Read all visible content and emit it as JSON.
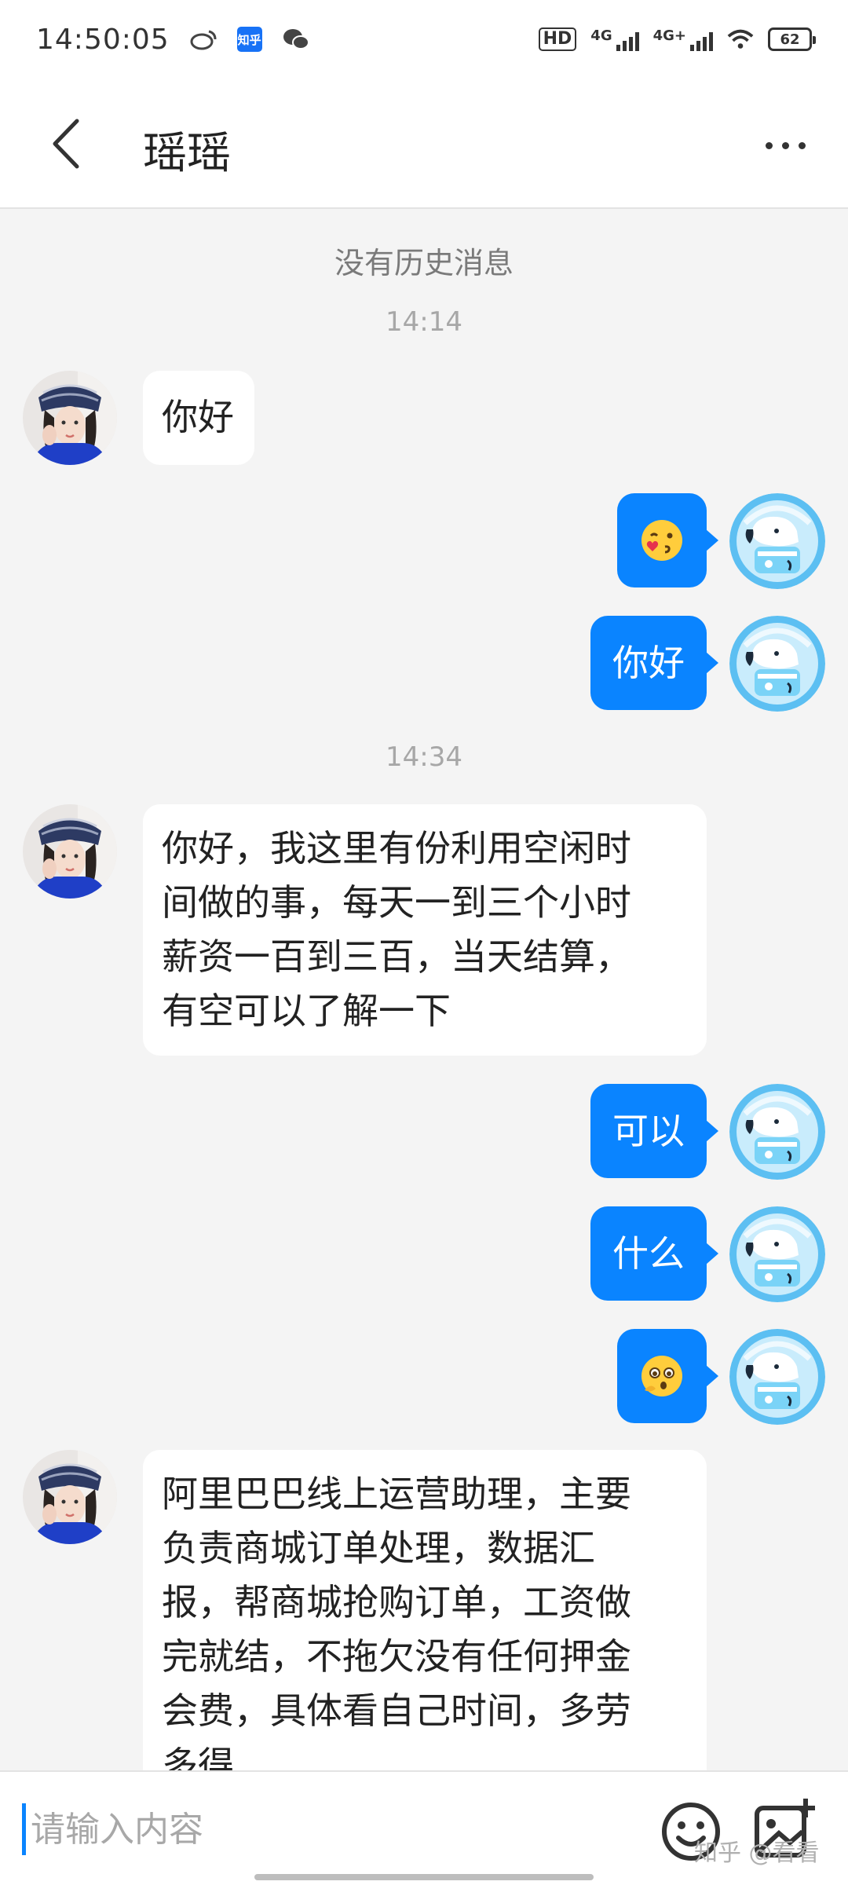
{
  "status_bar": {
    "time": "14:50:05",
    "app_badge": "知乎",
    "hd_label": "HD",
    "signal1_label": "4G",
    "signal2_label": "4G+",
    "battery_level": "62",
    "icons": [
      "weibo-icon",
      "zhihu-icon",
      "wechat-icon",
      "hd-icon",
      "signal-icon",
      "signal-icon",
      "wifi-icon",
      "battery-icon"
    ]
  },
  "header": {
    "title": "瑶瑶",
    "back_icon": "chevron-left-icon",
    "more_icon": "more-horizontal-icon"
  },
  "chat": {
    "no_history": "没有历史消息",
    "timestamps": [
      "14:14",
      "14:34"
    ],
    "messages": [
      {
        "side": "left",
        "text": "你好"
      },
      {
        "side": "right",
        "emoji": "kiss-emoji"
      },
      {
        "side": "right",
        "text": "你好"
      },
      {
        "side": "left",
        "lines": [
          "你好，我这里有份利用空闲时",
          "间做的事，每天一到三个小时",
          "薪资一百到三百，当天结算，",
          "有空可以了解一下"
        ]
      },
      {
        "side": "right",
        "text": "可以"
      },
      {
        "side": "right",
        "text": "什么"
      },
      {
        "side": "right",
        "emoji": "curious-emoji"
      },
      {
        "side": "left",
        "lines": [
          "阿里巴巴线上运营助理，主要",
          "负责商城订单处理，数据汇",
          "报，帮商城抢购订单，工资做",
          "完就结，不拖欠没有任何押金",
          "会费，具体看自己时间，多劳",
          "多得"
        ]
      }
    ]
  },
  "input": {
    "placeholder": "请输入内容",
    "emoji_icon": "smiley-icon",
    "image_icon": "image-add-icon"
  },
  "watermark": "知乎 @看看",
  "colors": {
    "accent": "#0a84ff",
    "background": "#f4f4f4",
    "bubble_left": "#ffffff"
  }
}
